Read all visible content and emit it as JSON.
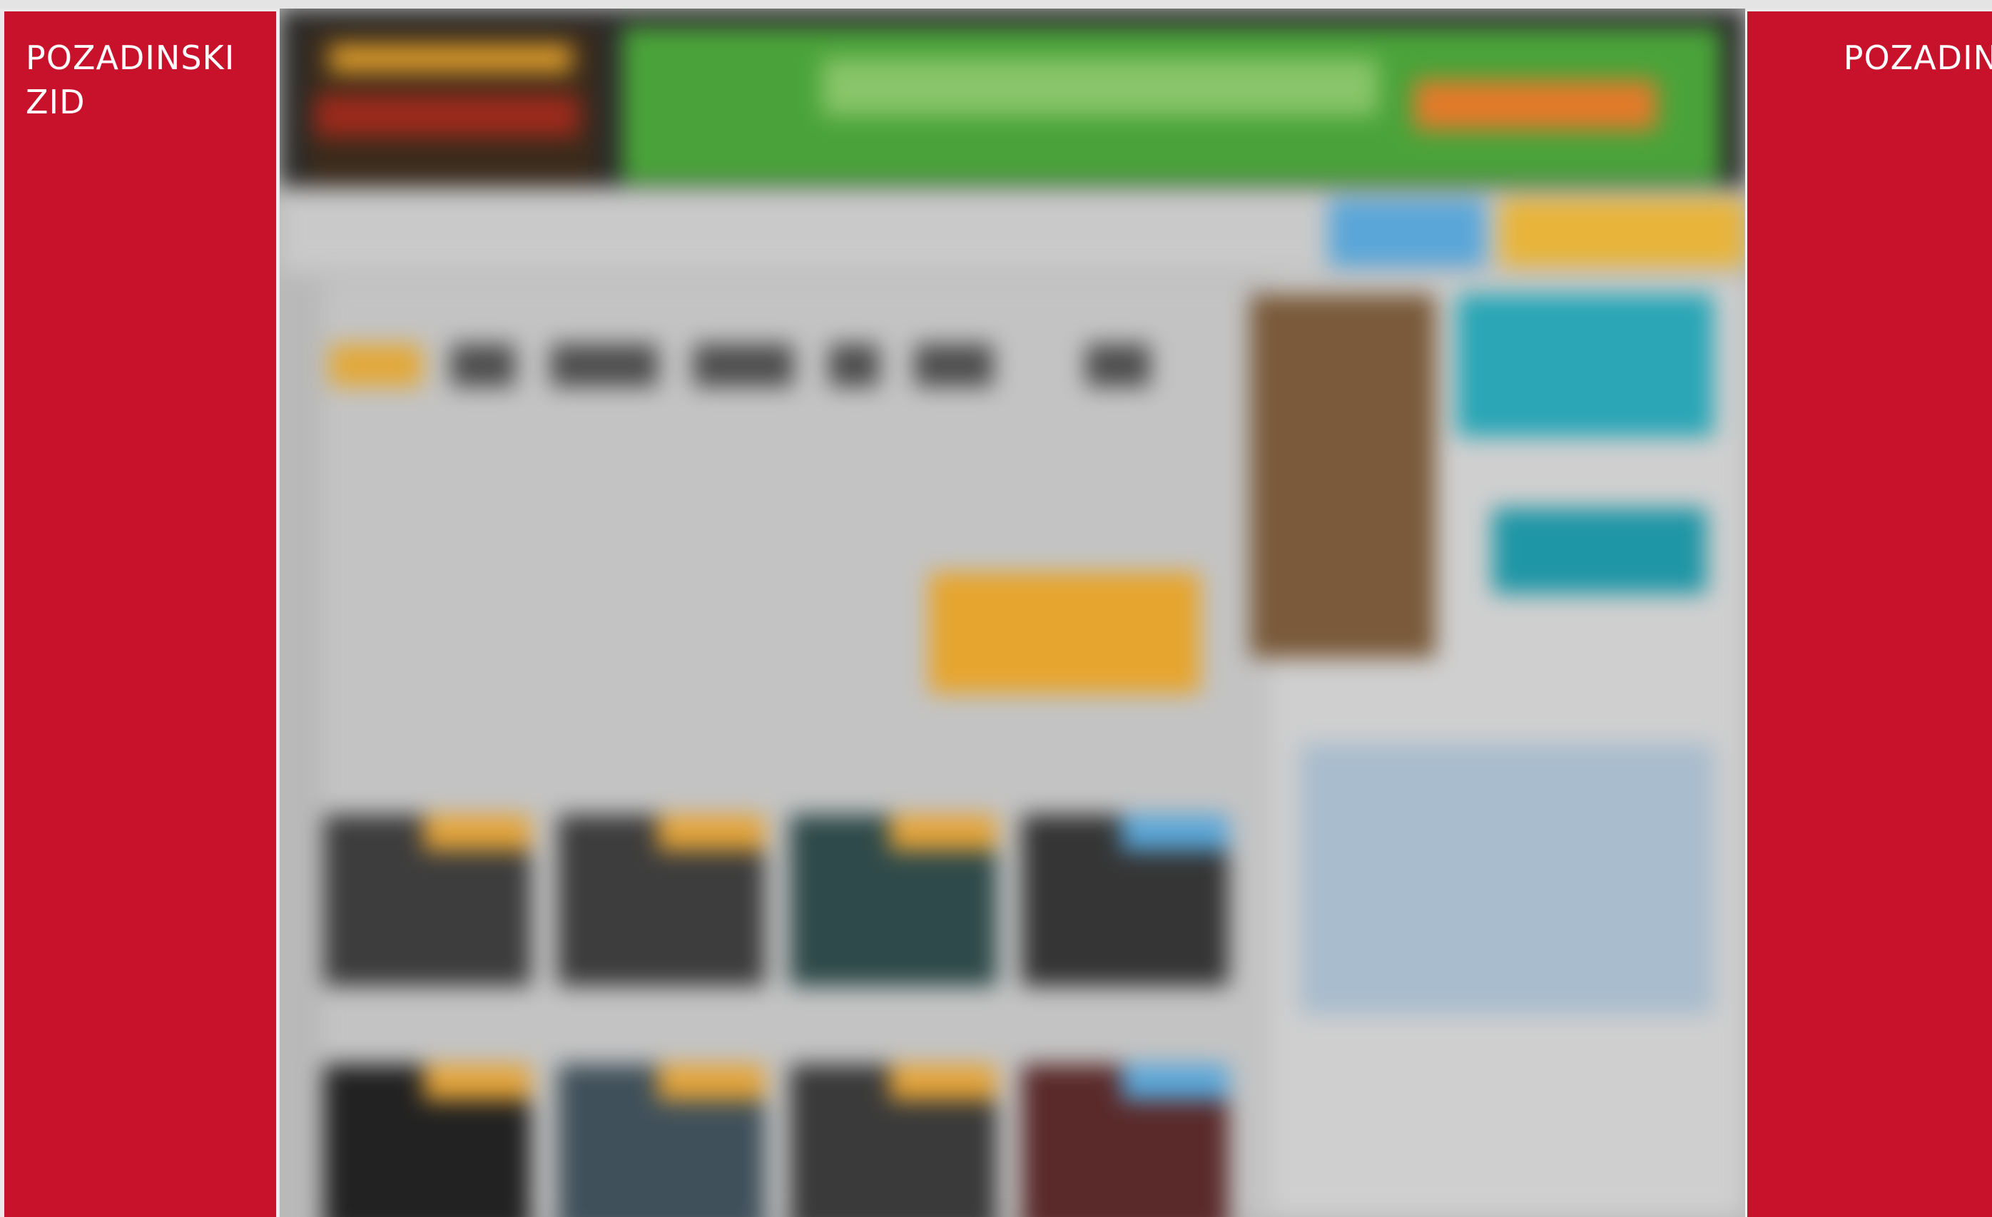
{
  "walls": {
    "left_label": "POZADINSKI\nZID",
    "right_label": "POZADINSKI\nZID"
  },
  "colors": {
    "wall": "#c8112b",
    "wall_text": "#ffffff",
    "accent_gold": "#e6a52f",
    "banner_green": "#4aa33a"
  }
}
